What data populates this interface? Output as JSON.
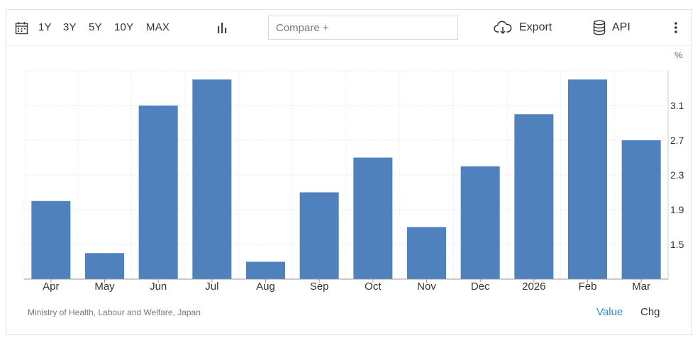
{
  "toolbar": {
    "calendar_icon": "calendar-icon",
    "ranges": [
      "1Y",
      "3Y",
      "5Y",
      "10Y",
      "MAX"
    ],
    "chart_type_icon": "bar-chart-icon",
    "compare_placeholder": "Compare +",
    "export_label": "Export",
    "export_icon": "cloud-download-icon",
    "api_label": "API",
    "api_icon": "database-icon",
    "more_icon": "vertical-dots-icon"
  },
  "footer": {
    "source": "Ministry of Health, Labour and Welfare, Japan",
    "value_label": "Value",
    "chg_label": "Chg",
    "active_color": "#2a8fd6"
  },
  "chart_data": {
    "type": "bar",
    "unit": "%",
    "categories": [
      "Apr",
      "May",
      "Jun",
      "Jul",
      "Aug",
      "Sep",
      "Oct",
      "Nov",
      "Dec",
      "2026",
      "Feb",
      "Mar"
    ],
    "values": [
      2.0,
      1.4,
      3.1,
      3.4,
      1.3,
      2.1,
      2.5,
      1.7,
      2.4,
      3.0,
      3.4,
      2.7
    ],
    "yticks": [
      1.5,
      1.9,
      2.3,
      2.7,
      3.1
    ],
    "ylim": [
      1.1,
      3.5
    ],
    "bar_color": "#4f81bd",
    "grid": true
  }
}
